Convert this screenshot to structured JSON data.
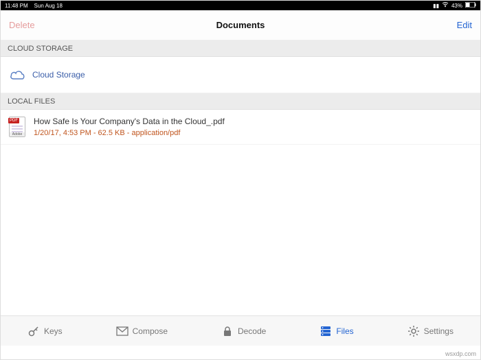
{
  "statusbar": {
    "time": "11:48 PM",
    "date": "Sun Aug 18",
    "battery": "43%"
  },
  "navbar": {
    "delete_label": "Delete",
    "title": "Documents",
    "edit_label": "Edit"
  },
  "sections": {
    "cloud_header": "CLOUD STORAGE",
    "cloud_item_label": "Cloud Storage",
    "local_header": "LOCAL FILES"
  },
  "files": [
    {
      "name": "How Safe Is Your Company's Data in the Cloud_.pdf",
      "meta": "1/20/17, 4:53 PM - 62.5 KB - application/pdf",
      "badge": "PDF"
    }
  ],
  "tabbar": {
    "keys": "Keys",
    "compose": "Compose",
    "decode": "Decode",
    "files": "Files",
    "settings": "Settings"
  },
  "watermark": "wsxdp.com"
}
